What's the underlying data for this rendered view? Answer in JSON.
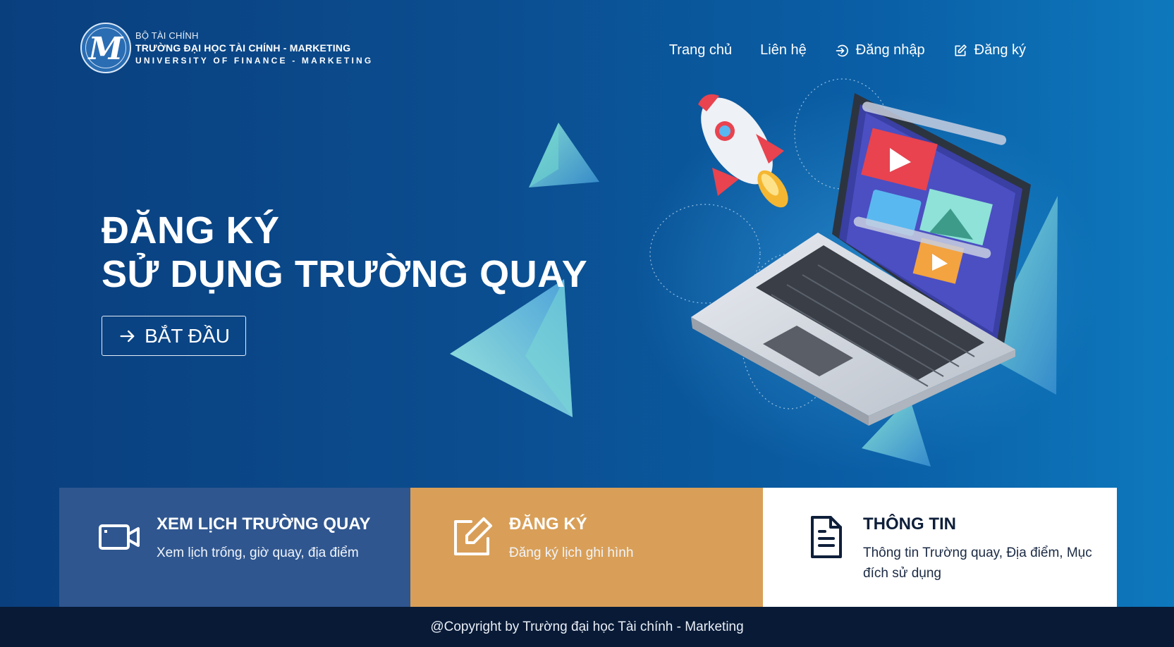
{
  "header": {
    "logo": {
      "line1": "BỘ TÀI CHÍNH",
      "line2": "TRƯỜNG ĐẠI HỌC TÀI CHÍNH - MARKETING",
      "line3": "UNIVERSITY OF FINANCE - MARKETING"
    },
    "nav": {
      "home": "Trang chủ",
      "contact": "Liên hệ",
      "login": "Đăng nhập",
      "register": "Đăng ký"
    }
  },
  "hero": {
    "title_line1": "ĐĂNG KÝ",
    "title_line2": "SỬ DỤNG TRƯỜNG QUAY",
    "start_button": "BẮT ĐẦU"
  },
  "cards": [
    {
      "title": "XEM LỊCH TRƯỜNG QUAY",
      "desc": "Xem lịch trống, giờ quay, địa điểm",
      "icon": "video-camera-icon",
      "bg": "#2f568f"
    },
    {
      "title": "ĐĂNG KÝ",
      "desc": "Đăng ký lịch ghi hình",
      "icon": "edit-icon",
      "bg": "#d99f58"
    },
    {
      "title": "THÔNG TIN",
      "desc": "Thông tin Trường quay, Địa điểm, Mục đích sử dụng",
      "icon": "document-icon",
      "bg": "#ffffff"
    }
  ],
  "footer": {
    "copyright": "@Copyright by Trường đại học Tài chính - Marketing"
  },
  "colors": {
    "accent_orange": "#d99f58",
    "accent_blue": "#2f568f",
    "footer_bg": "#081a36"
  }
}
